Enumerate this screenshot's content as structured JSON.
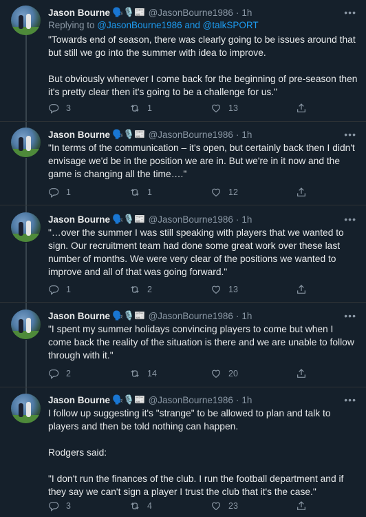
{
  "tweets": [
    {
      "name": "Jason Bourne",
      "emojis": "🗣️🎙️📰",
      "handle": "@JasonBourne1986",
      "time": "1h",
      "reply_prefix": "Replying to ",
      "reply_handles": "@JasonBourne1986 and @talkSPORT",
      "paragraphs": [
        "\"Towards end of season, there was clearly going to be issues around that but still we go into the summer with idea to improve.",
        "But obviously whenever I come back for the beginning of pre-season then it's pretty clear then it's going to be a challenge for us.\""
      ],
      "replies": "3",
      "retweets": "1",
      "likes": "13"
    },
    {
      "name": "Jason Bourne",
      "emojis": "🗣️🎙️📰",
      "handle": "@JasonBourne1986",
      "time": "1h",
      "paragraphs": [
        "\"In terms of the communication – it's open, but certainly back then I didn't envisage we'd be in the position we are in. But we're in it now and the game is changing all the time….\""
      ],
      "replies": "1",
      "retweets": "1",
      "likes": "12"
    },
    {
      "name": "Jason Bourne",
      "emojis": "🗣️🎙️📰",
      "handle": "@JasonBourne1986",
      "time": "1h",
      "paragraphs": [
        "\"…over the summer I was still speaking with players that we wanted to sign. Our recruitment team had done some great work over these last number of months. We were very clear of the positions we wanted to improve and all of that was going forward.\""
      ],
      "replies": "1",
      "retweets": "2",
      "likes": "13"
    },
    {
      "name": "Jason Bourne",
      "emojis": "🗣️🎙️📰",
      "handle": "@JasonBourne1986",
      "time": "1h",
      "paragraphs": [
        "\"I spent my summer holidays convincing players to come but when I come back the reality of the situation is there and we are unable to follow through with it.\""
      ],
      "replies": "2",
      "retweets": "14",
      "likes": "20"
    },
    {
      "name": "Jason Bourne",
      "emojis": "🗣️🎙️📰",
      "handle": "@JasonBourne1986",
      "time": "1h",
      "paragraphs": [
        "I follow up suggesting it's \"strange\" to be allowed to plan and talk to players and then be told nothing can happen.",
        "Rodgers said:",
        "\"I don't run the finances of the club. I run the football department and if they say we can't sign a player I trust the club that it's the case.\""
      ],
      "replies": "3",
      "retweets": "4",
      "likes": "23"
    }
  ],
  "more_label": "•••",
  "dot": "·"
}
